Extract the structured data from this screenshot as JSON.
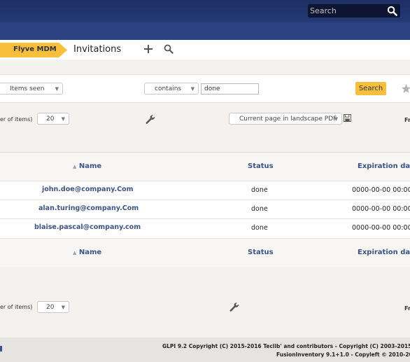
{
  "header": {
    "search_placeholder": "Search"
  },
  "breadcrumb": {
    "plugin": "Flyve MDM",
    "title": "Invitations"
  },
  "criteria": {
    "field": "Items seen",
    "operator": "contains",
    "value": "done",
    "search_button": "Search"
  },
  "pager_top": {
    "per_page_label": "er of items)",
    "per_page_value": "20",
    "export_option": "Current page in landscape PDF",
    "right_text": "Fr"
  },
  "table": {
    "columns": {
      "name": "Name",
      "status": "Status",
      "expiration": "Expiration dat"
    },
    "sort_marker": "▲",
    "rows": [
      {
        "name": "john.doe@company.Com",
        "status": "done",
        "expiration": "0000-00-00 00:00"
      },
      {
        "name": "alan.turing@company.Com",
        "status": "done",
        "expiration": "0000-00-00 00:00"
      },
      {
        "name": "blaise.pascal@company.com",
        "status": "done",
        "expiration": "0000-00-00 00:00"
      }
    ]
  },
  "pager_bottom": {
    "per_page_label": "er of items)",
    "per_page_value": "20",
    "right_text": "Fr"
  },
  "footer": {
    "line1": "GLPI 9.2 Copyright (C) 2015-2016 Teclib' and contributors - Copyright (C) 2003-2015 IN",
    "line2": "FusionInventory 9.1+1.0 - Copyleft © 2010-20"
  }
}
